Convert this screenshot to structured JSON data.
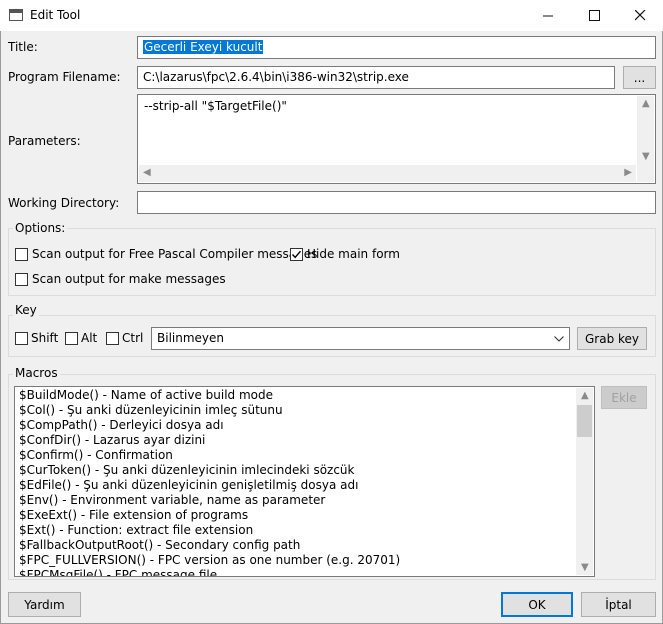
{
  "window": {
    "title": "Edit Tool",
    "controls": [
      "minimize",
      "maximize",
      "close"
    ]
  },
  "form": {
    "title_label": "Title:",
    "title_value": "Gecerli Exeyi kucult",
    "program_label": "Program Filename:",
    "program_value": "C:\\lazarus\\fpc\\2.6.4\\bin\\i386-win32\\strip.exe",
    "browse_label": "...",
    "parameters_label": "Parameters:",
    "parameters_value": "--strip-all \"$TargetFile()\"",
    "workdir_label": "Working Directory:",
    "workdir_value": ""
  },
  "options": {
    "title": "Options:",
    "scan_fpc_label": "Scan output for Free Pascal Compiler messages",
    "scan_fpc_checked": false,
    "hide_main_label": "Hide main form",
    "hide_main_checked": true,
    "scan_make_label": "Scan output for make messages",
    "scan_make_checked": false
  },
  "key": {
    "title": "Key",
    "shift_label": "Shift",
    "alt_label": "Alt",
    "ctrl_label": "Ctrl",
    "key_value": "Bilinmeyen",
    "grab_label": "Grab key"
  },
  "macros": {
    "title": "Macros",
    "insert_label": "Ekle",
    "items": [
      "$BuildMode() - Name of active build mode",
      "$Col() - Şu anki düzenleyicinin imleç sütunu",
      "$CompPath() - Derleyici dosya adı",
      "$ConfDir() - Lazarus ayar dizini",
      "$Confirm() - Confirmation",
      "$CurToken() - Şu anki düzenleyicinin imlecindeki sözcük",
      "$EdFile() - Şu anki düzenleyicinin genişletilmiş dosya adı",
      "$Env() - Environment variable, name as parameter",
      "$ExeExt() - File extension of programs",
      "$Ext() - Function: extract file extension",
      "$FallbackOutputRoot() - Secondary config path",
      "$FPC_FULLVERSION() - FPC version as one number (e.g. 20701)",
      "$FPCMsgFile() - FPC message file"
    ]
  },
  "footer": {
    "help_label": "Yardım",
    "ok_label": "OK",
    "cancel_label": "İptal"
  }
}
